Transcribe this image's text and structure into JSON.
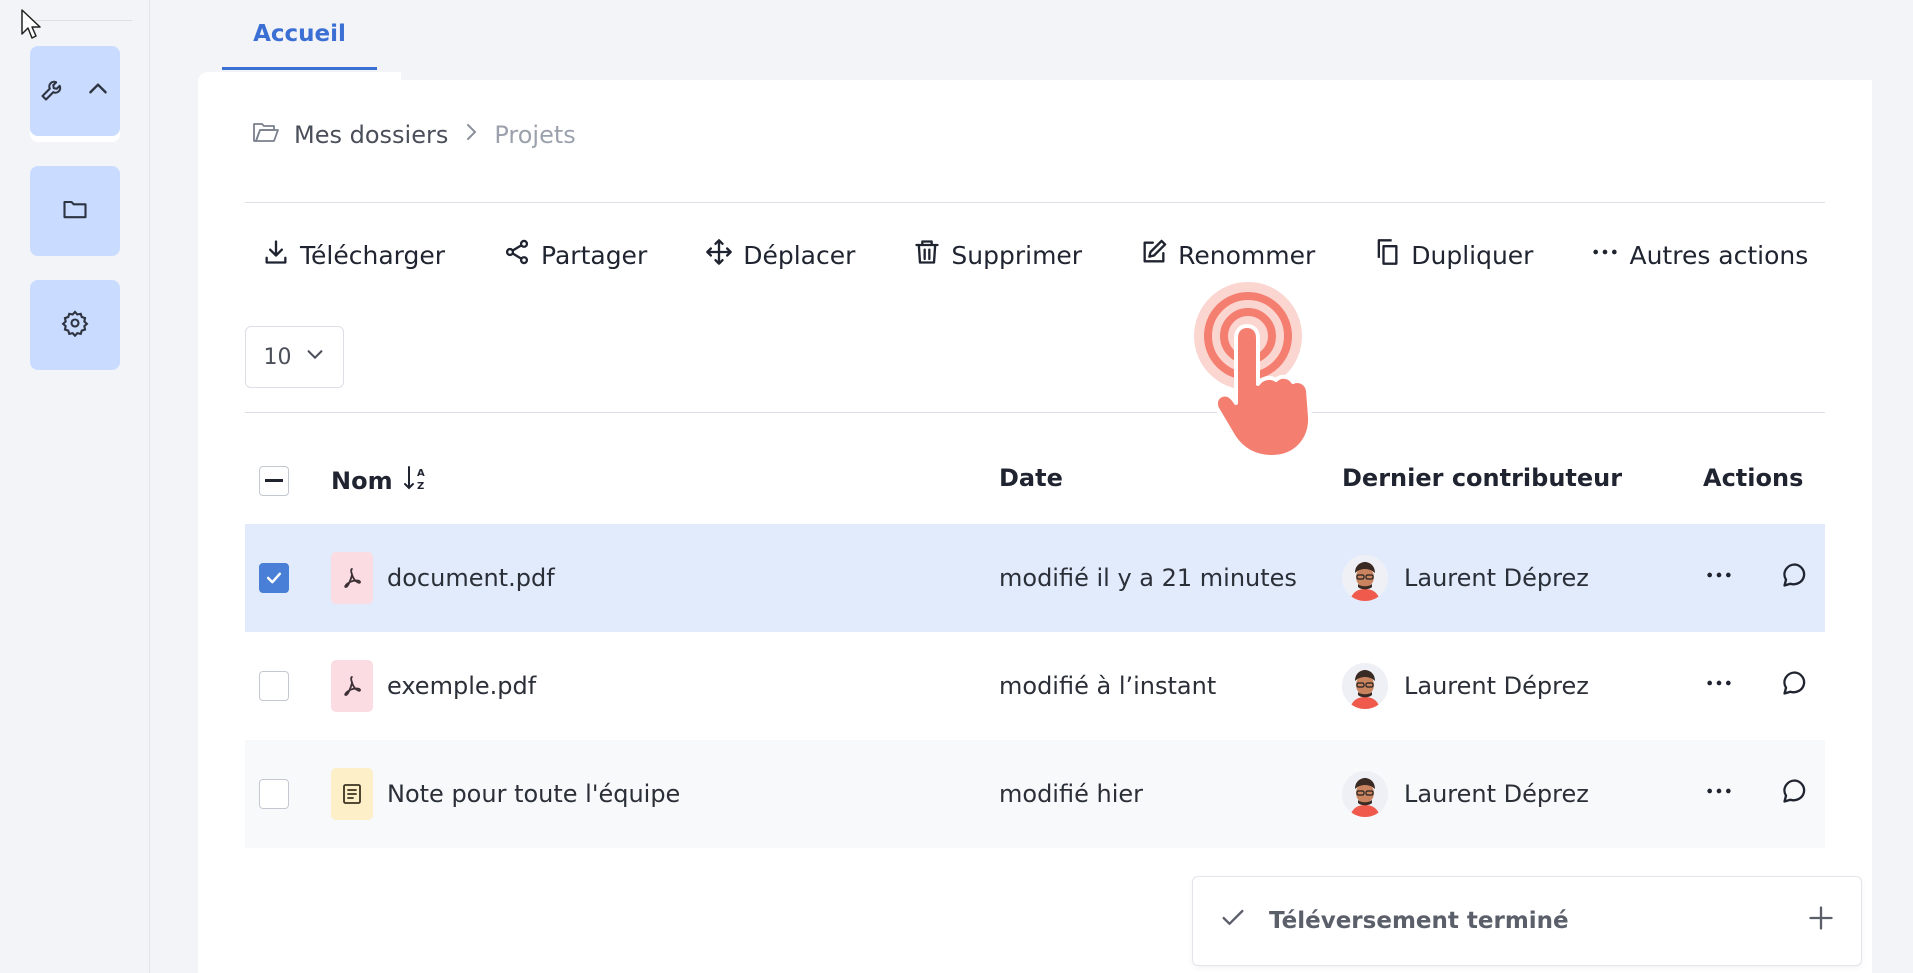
{
  "tab": {
    "label": "Accueil"
  },
  "breadcrumb": {
    "root": "Mes dossiers",
    "current": "Projets"
  },
  "toolbar": {
    "download": "Télécharger",
    "share": "Partager",
    "move": "Déplacer",
    "delete": "Supprimer",
    "rename": "Renommer",
    "duplicate": "Dupliquer",
    "more": "Autres actions"
  },
  "pager": {
    "value": "10"
  },
  "table": {
    "headers": {
      "name": "Nom",
      "date": "Date",
      "contributor": "Dernier contributeur",
      "actions": "Actions"
    },
    "rows": [
      {
        "name": "document.pdf",
        "date": "modifié il y a 21 minutes",
        "contributor": "Laurent Déprez",
        "type": "pdf",
        "selected": true
      },
      {
        "name": "exemple.pdf",
        "date": "modifié à l’instant",
        "contributor": "Laurent Déprez",
        "type": "pdf",
        "selected": false
      },
      {
        "name": "Note pour toute l'équipe",
        "date": "modifié hier",
        "contributor": "Laurent Déprez",
        "type": "note",
        "selected": false
      }
    ]
  },
  "toast": {
    "text": "Téléversement terminé"
  },
  "colors": {
    "accent": "#3b6fd4",
    "sidebar_button": "#c9dbff",
    "selected_row": "#e2ebfc",
    "hand": "#f47e6f"
  }
}
